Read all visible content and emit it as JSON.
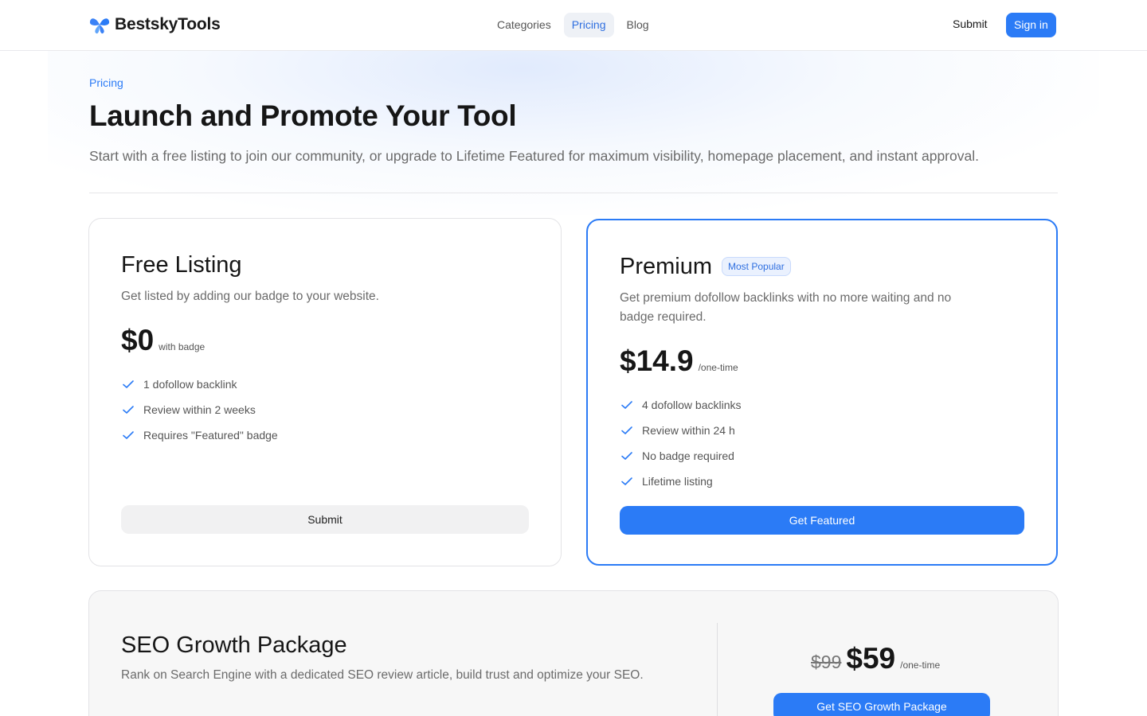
{
  "header": {
    "brand": "BestskyTools",
    "nav": [
      {
        "label": "Categories",
        "active": false
      },
      {
        "label": "Pricing",
        "active": true
      },
      {
        "label": "Blog",
        "active": false
      }
    ],
    "submit_label": "Submit",
    "signin_label": "Sign in"
  },
  "hero": {
    "eyebrow": "Pricing",
    "title": "Launch and Promote Your Tool",
    "subtitle": "Start with a free listing to join our community, or upgrade to Lifetime Featured for maximum visibility, homepage placement, and instant approval."
  },
  "plans": {
    "free": {
      "title": "Free Listing",
      "description": "Get listed by adding our badge to your website.",
      "price": "$0",
      "price_note": "with badge",
      "features": [
        "1 dofollow backlink",
        "Review within 2 weeks",
        "Requires \"Featured\" badge"
      ],
      "cta": "Submit"
    },
    "premium": {
      "title": "Premium",
      "badge": "Most Popular",
      "description": "Get premium dofollow backlinks with no more waiting and no badge required.",
      "price": "$14.9",
      "price_note": "/one-time",
      "features": [
        "4 dofollow backlinks",
        "Review within 24 h",
        "No badge required",
        "Lifetime listing"
      ],
      "cta": "Get Featured"
    }
  },
  "seo": {
    "title": "SEO Growth Package",
    "description": "Rank on Search Engine with a dedicated SEO review article, build trust and optimize your SEO.",
    "old_price": "$99",
    "price": "$59",
    "price_note": "/one-time",
    "cta": "Get SEO Growth Package"
  },
  "icons": {
    "logo": "butterfly-logo-icon",
    "feature_check": "check-icon"
  },
  "colors": {
    "accent": "#2b7bf6",
    "text": "#161616",
    "muted": "#6b6b6b"
  }
}
